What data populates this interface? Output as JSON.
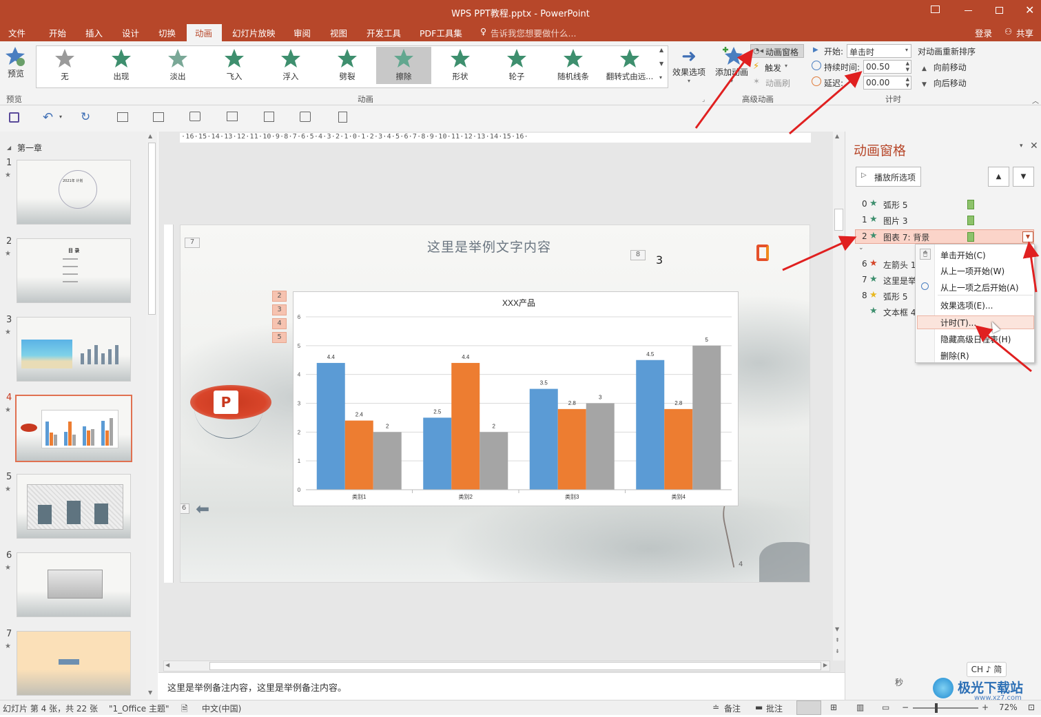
{
  "window": {
    "title": "WPS PPT教程.pptx - PowerPoint"
  },
  "menu": {
    "items": [
      "文件",
      "开始",
      "插入",
      "设计",
      "切换",
      "动画",
      "幻灯片放映",
      "审阅",
      "视图",
      "开发工具",
      "PDF工具集"
    ],
    "active": "动画",
    "tell_me": "告诉我您想要做什么...",
    "login": "登录",
    "share": "共享"
  },
  "ribbon": {
    "preview_label": "预览",
    "preview_group": "预览",
    "animations": [
      "无",
      "出现",
      "淡出",
      "飞入",
      "浮入",
      "劈裂",
      "擦除",
      "形状",
      "轮子",
      "随机线条",
      "翻转式由远..."
    ],
    "selected_animation": "擦除",
    "effect_options": "效果选项",
    "animation_group": "动画",
    "add_animation": "添加动画",
    "animation_pane": "动画窗格",
    "trigger": "触发",
    "animation_painter": "动画刷",
    "advanced_group": "高级动画",
    "start_label": "开始:",
    "start_value": "单击时",
    "duration_label": "持续时间:",
    "duration_value": "00.50",
    "delay_label": "延迟:",
    "delay_value": "00.00",
    "reorder_title": "对动画重新排序",
    "move_earlier": "向前移动",
    "move_later": "向后移动",
    "timing_group": "计时"
  },
  "thumbnails": {
    "section": "第一章",
    "slides": [
      {
        "num": "1"
      },
      {
        "num": "2"
      },
      {
        "num": "3"
      },
      {
        "num": "4"
      },
      {
        "num": "5"
      },
      {
        "num": "6"
      },
      {
        "num": "7"
      }
    ],
    "thumb_texts": {
      "s1_title": "2021年 计划",
      "s2_title": "目 录"
    }
  },
  "ruler": {
    "top": "·16·15·14·13·12·11·10·9·8·7·6·5·4·3·2·1·0·1·2·3·4·5·6·7·8·9·10·11·12·13·14·15·16·"
  },
  "slide": {
    "title": "这里是举例文字内容",
    "tag_7": "7",
    "tag_8": "8",
    "tag_6": "6",
    "tag_3_text": "3",
    "anim_tags": [
      "2",
      "3",
      "4",
      "5"
    ],
    "bottom_num": "4",
    "logo_letter": "P"
  },
  "chart_data": {
    "type": "bar",
    "title": "XXX产品",
    "categories": [
      "类别1",
      "类别2",
      "类别3",
      "类别4"
    ],
    "series": [
      {
        "values": [
          4.4,
          2.5,
          3.5,
          4.5
        ],
        "color": "#5b9bd5"
      },
      {
        "values": [
          2.4,
          4.4,
          2.8,
          2.8
        ],
        "color": "#ed7d31"
      },
      {
        "values": [
          2,
          2,
          3,
          5
        ],
        "color": "#a5a5a5"
      }
    ],
    "ylim": [
      0,
      6
    ],
    "yticks": [
      "0",
      "1",
      "2",
      "3",
      "4",
      "5",
      "6"
    ],
    "grid": true
  },
  "notes": {
    "text": "这里是举例备注内容，这里是举例备注内容。"
  },
  "anim_pane": {
    "title": "动画窗格",
    "play_button": "播放所选项",
    "items": [
      {
        "num": "0",
        "label": "弧形 5"
      },
      {
        "num": "1",
        "label": "图片 3"
      },
      {
        "num": "2",
        "label": "图表 7: 背景"
      },
      {
        "num": "6",
        "label": "左箭头 1"
      },
      {
        "num": "7",
        "label": "这里是举"
      },
      {
        "num": "8",
        "label": "弧形 5"
      },
      {
        "num": "",
        "label": "文本框 4"
      }
    ],
    "seconds": "秒",
    "ime": "CH ♪ 简"
  },
  "context_menu": {
    "items": [
      "单击开始(C)",
      "从上一项开始(W)",
      "从上一项之后开始(A)",
      "效果选项(E)...",
      "计时(T)...",
      "隐藏高级日程表(H)",
      "删除(R)"
    ]
  },
  "status": {
    "slide_info": "幻灯片 第 4 张，共 22 张",
    "theme": "\"1_Office 主题\"",
    "language": "中文(中国)",
    "notes": "备注",
    "comments": "批注",
    "zoom": "72%"
  },
  "watermark": {
    "text": "极光下载站",
    "url": "www.xz7.com"
  },
  "colors": {
    "accent": "#b7472a",
    "arrow": "#e02020",
    "selected_row": "#fbd4c9"
  }
}
